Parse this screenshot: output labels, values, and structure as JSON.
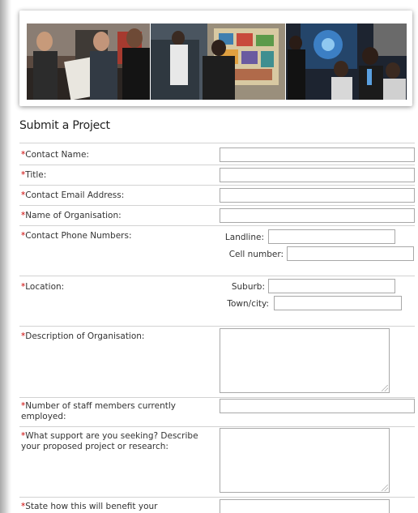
{
  "form": {
    "title": "Submit a Project",
    "required_marker": "*",
    "fields": {
      "contact_name": "Contact Name:",
      "title": "Title:",
      "email": "Contact Email Address:",
      "organisation": "Name of Organisation:",
      "phone": "Contact Phone Numbers:",
      "landline": "Landline:",
      "cell": "Cell number:",
      "location": "Location:",
      "suburb": "Suburb:",
      "town": "Town/city:",
      "description": "Description of Organisation:",
      "staff": "Number of staff members currently employed:",
      "support": "What support are you seeking? Describe your proposed project or research:",
      "benefit": "State how this will benefit your"
    }
  },
  "colors": {
    "required": "#cc0000",
    "divider": "#d2d2d2",
    "input_border": "#a8a8a8"
  }
}
